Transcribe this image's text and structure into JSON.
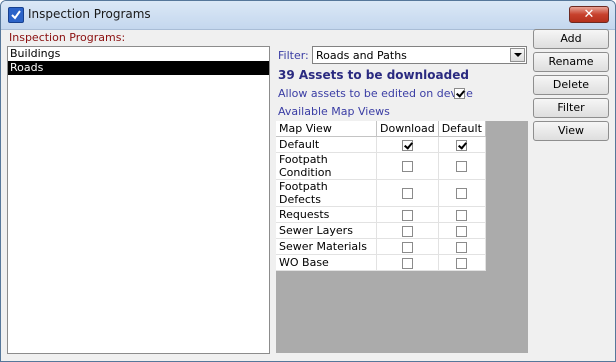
{
  "window": {
    "title": "Inspection Programs"
  },
  "programs": {
    "label": "Inspection Programs:",
    "items": [
      {
        "label": "Buildings",
        "selected": false
      },
      {
        "label": "Roads",
        "selected": true
      }
    ]
  },
  "filter": {
    "label": "Filter:",
    "value": "Roads and Paths"
  },
  "assets_count": "39 Assets to be downloaded",
  "allow_edit": {
    "label": "Allow assets to be edited on device",
    "checked": true
  },
  "map_views": {
    "label": "Available Map Views",
    "columns": [
      "Map View",
      "Download",
      "Default"
    ],
    "rows": [
      {
        "name": "Default",
        "download": true,
        "default": true
      },
      {
        "name": "Footpath Condition",
        "download": false,
        "default": false
      },
      {
        "name": "Footpath Defects",
        "download": false,
        "default": false
      },
      {
        "name": "Requests",
        "download": false,
        "default": false
      },
      {
        "name": "Sewer Layers",
        "download": false,
        "default": false
      },
      {
        "name": "Sewer Materials",
        "download": false,
        "default": false
      },
      {
        "name": "WO Base",
        "download": false,
        "default": false
      }
    ]
  },
  "buttons": {
    "add": "Add",
    "rename": "Rename",
    "delete": "Delete",
    "filter": "Filter",
    "view": "View"
  },
  "colors": {
    "selection": "#000000",
    "grid_background": "#ababab",
    "label_red": "#8b1010",
    "label_blue": "#3a3da4"
  }
}
